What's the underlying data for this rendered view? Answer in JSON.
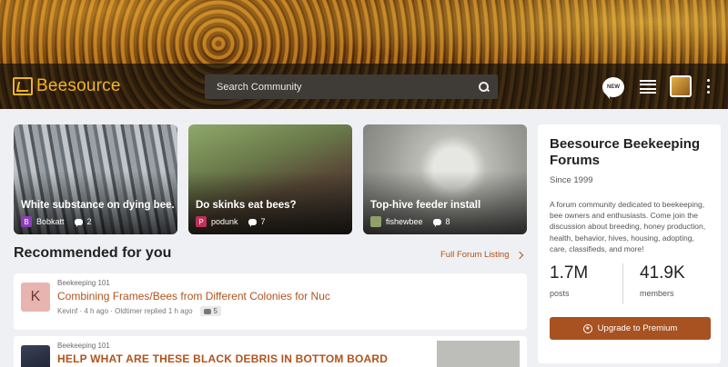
{
  "header": {
    "logo_text": "Beesource",
    "search_placeholder": "Search Community",
    "new_label": "NEW"
  },
  "featured": [
    {
      "title": "White substance on dying bee.",
      "author": "Bobkatt",
      "author_initial": "B",
      "avatar_color": "#8b3fb8",
      "replies": "2"
    },
    {
      "title": "Do skinks eat bees?",
      "author": "podunk",
      "author_initial": "P",
      "avatar_color": "#c0305a",
      "replies": "7"
    },
    {
      "title": "Top-hive feeder install",
      "author": "fishewbee",
      "author_initial": "",
      "avatar_color": "#8fa06a",
      "replies": "8"
    }
  ],
  "recommended": {
    "heading": "Recommended for you",
    "full_listing": "Full Forum Listing",
    "posts": [
      {
        "category": "Beekeeping 101",
        "title": "Combining Frames/Bees from Different Colonies for Nuc",
        "avatar_initial": "K",
        "meta": "Kevinf · 4 h ago · Oldtimer replied 1 h ago",
        "replies": "5"
      },
      {
        "category": "Beekeeping 101",
        "title": "HELP WHAT ARE THESE BLACK DEBRIS IN BOTTOM BOARD"
      }
    ]
  },
  "sidebar": {
    "title": "Beesource Beekeeping Forums",
    "since": "Since 1999",
    "description": "A forum community dedicated to beekeeping, bee owners and enthusiasts. Come join the discussion about breeding, honey production, health, behavior, hives, housing, adopting, care, classifieds, and more!",
    "posts_count": "1.7M",
    "posts_label": "posts",
    "members_count": "41.9K",
    "members_label": "members",
    "upgrade_label": "Upgrade to Premium"
  },
  "colors": {
    "accent": "#b0531d",
    "button": "#a85121",
    "logo": "#f0b429"
  }
}
